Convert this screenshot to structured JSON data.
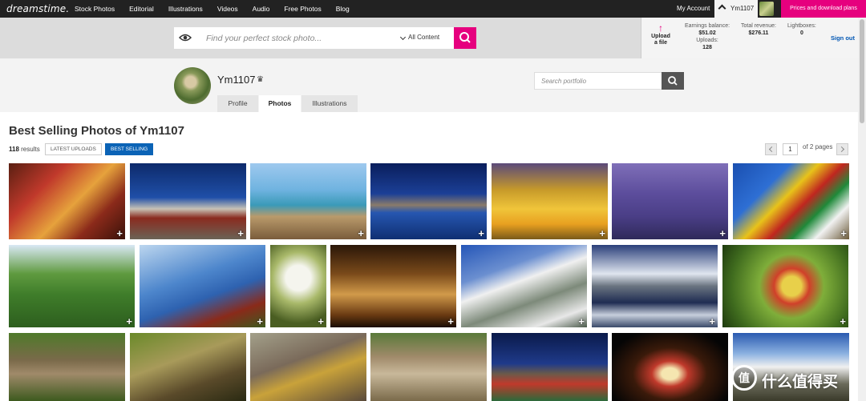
{
  "nav": {
    "logo": "dreamstime.",
    "links": [
      "Stock Photos",
      "Editorial",
      "Illustrations",
      "Videos",
      "Audio",
      "Free Photos",
      "Blog"
    ],
    "my_account": "My Account",
    "username": "Ym1107",
    "pricing": "Prices and download plans"
  },
  "search": {
    "placeholder": "Find your perfect stock photo...",
    "scope": "All Content"
  },
  "account": {
    "upload_label": "Upload a file",
    "earnings_label": "Earnings balance:",
    "earnings_value": "$51.02",
    "uploads_label": "Uploads:",
    "uploads_value": "128",
    "revenue_label": "Total revenue:",
    "revenue_value": "$276.11",
    "lightboxes_label": "Lightboxes:",
    "lightboxes_value": "0",
    "signout": "Sign out"
  },
  "profile": {
    "name": "Ym1107",
    "crown": "♛",
    "tabs": [
      "Profile",
      "Photos",
      "Illustrations"
    ],
    "active_tab": "Photos",
    "portfolio_placeholder": "Search portfolio"
  },
  "content": {
    "heading": "Best Selling Photos of Ym1107",
    "results_count": "118",
    "results_label": "results",
    "sort_latest": "LATEST UPLOADS",
    "sort_best": "BEST SELLING",
    "page_current": "1",
    "page_total_label": "of 2 pages"
  },
  "photos": [
    {
      "subject": "prayer wheels"
    },
    {
      "subject": "Potala Palace"
    },
    {
      "subject": "lakeside rocks and yak skull"
    },
    {
      "subject": "mountain lake at dusk"
    },
    {
      "subject": "golden Buddha shrine"
    },
    {
      "subject": "lavender field"
    },
    {
      "subject": "prayer flags"
    },
    {
      "subject": "lotus pond"
    },
    {
      "subject": "prayer flags and monastery"
    },
    {
      "subject": "white tulips"
    },
    {
      "subject": "hanging wine glasses"
    },
    {
      "subject": "snowy mountain forest"
    },
    {
      "subject": "mountain lake reflection"
    },
    {
      "subject": "glass sculpture"
    },
    {
      "subject": "monkeys"
    },
    {
      "subject": "tree roots"
    },
    {
      "subject": "rock carvings"
    },
    {
      "subject": "river rapids"
    },
    {
      "subject": "prayer flags at lake"
    },
    {
      "subject": "Potala Palace at night"
    },
    {
      "subject": "snow peak with yaks"
    }
  ],
  "plus_icon": "+",
  "watermark": {
    "icon": "值",
    "text": "什么值得买"
  },
  "colors": {
    "accent": "#e6007e",
    "primary": "#0b63b6",
    "nav_bg": "#222222"
  }
}
